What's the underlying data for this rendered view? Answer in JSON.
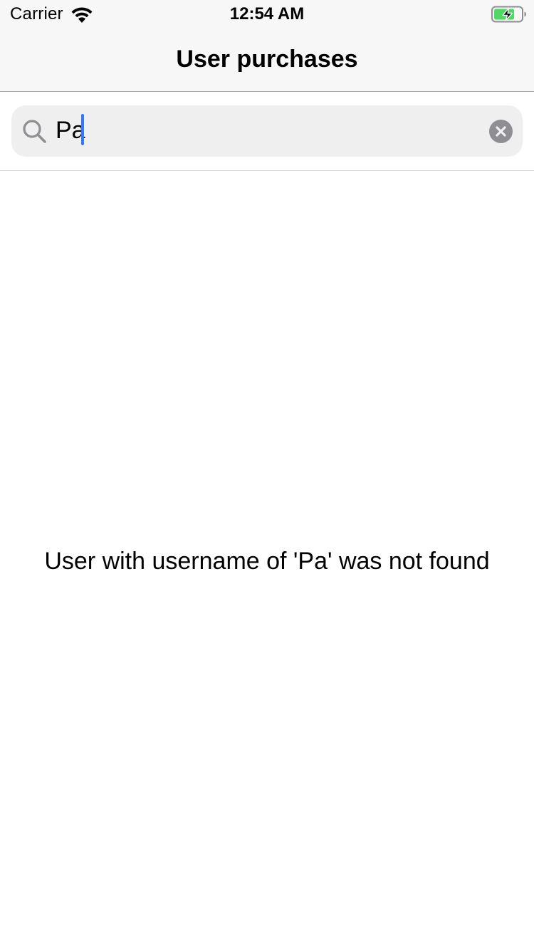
{
  "status_bar": {
    "carrier": "Carrier",
    "time": "12:54 AM",
    "wifi_icon": "wifi-icon",
    "battery_icon": "battery-charging-icon",
    "battery_color": "#4cd964"
  },
  "nav": {
    "title": "User purchases"
  },
  "search": {
    "value": "Pa",
    "search_icon": "magnifying-glass-icon",
    "clear_icon": "clear-circle-icon",
    "caret_color": "#3478f6"
  },
  "main": {
    "empty_message": "User with username of 'Pa' was not found"
  }
}
